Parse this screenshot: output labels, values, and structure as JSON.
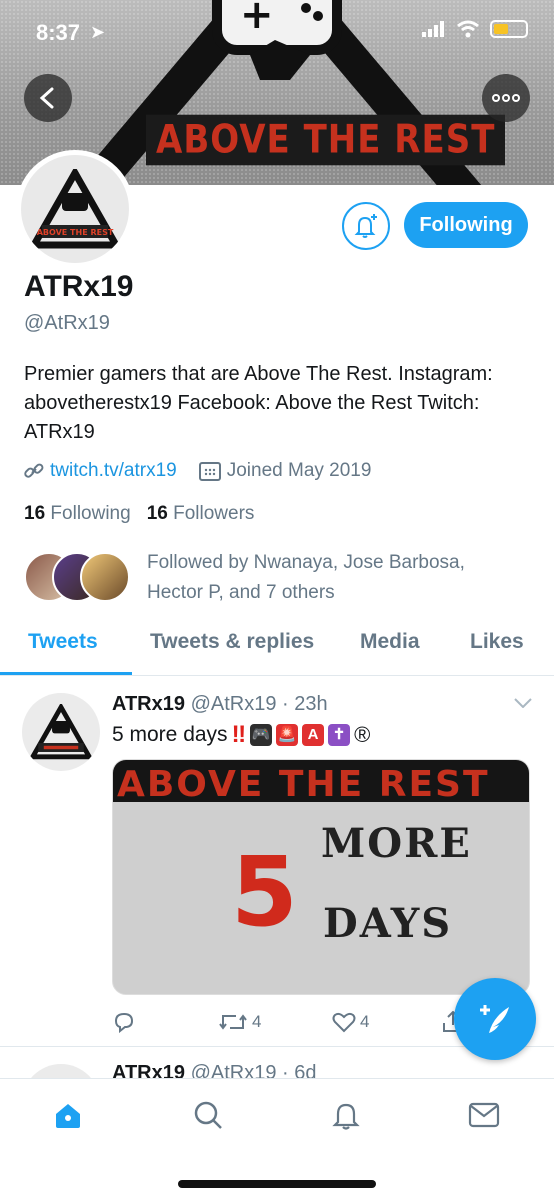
{
  "status_bar": {
    "time": "8:37"
  },
  "banner": {
    "text": "ABOVE THE REST"
  },
  "profile": {
    "name": "ATRx19",
    "handle": "@AtRx19",
    "bio": "Premier gamers that are Above The Rest. Instagram: abovetherestx19 Facebook: Above the Rest Twitch: ATRx19",
    "link": "twitch.tv/atrx19",
    "joined": "Joined May 2019",
    "following_count": "16",
    "following_label": "Following",
    "followers_count": "16",
    "followers_label": "Followers",
    "followed_by_line1": "Followed by Nwanaya, Jose Barbosa,",
    "followed_by_line2": "Hector P, and 7 others",
    "follow_button_label": "Following",
    "avatar_text": "ABOVE THE REST"
  },
  "tabs": [
    "Tweets",
    "Tweets & replies",
    "Media",
    "Likes"
  ],
  "tweets": [
    {
      "name": "ATRx19",
      "handle": "@AtRx19",
      "time": "23h",
      "text": "5 more days",
      "media": {
        "top_text": "ABOVE THE REST",
        "number": "5",
        "line1": "MORE",
        "line2": "DAYS"
      },
      "retweets": "4",
      "likes": "4"
    },
    {
      "name": "ATRx19",
      "handle": "@AtRx19",
      "time": "6d"
    }
  ],
  "colors": {
    "accent": "#1da1f2",
    "text": "#14171a",
    "muted": "#657786",
    "brand_red": "#c6311e"
  }
}
